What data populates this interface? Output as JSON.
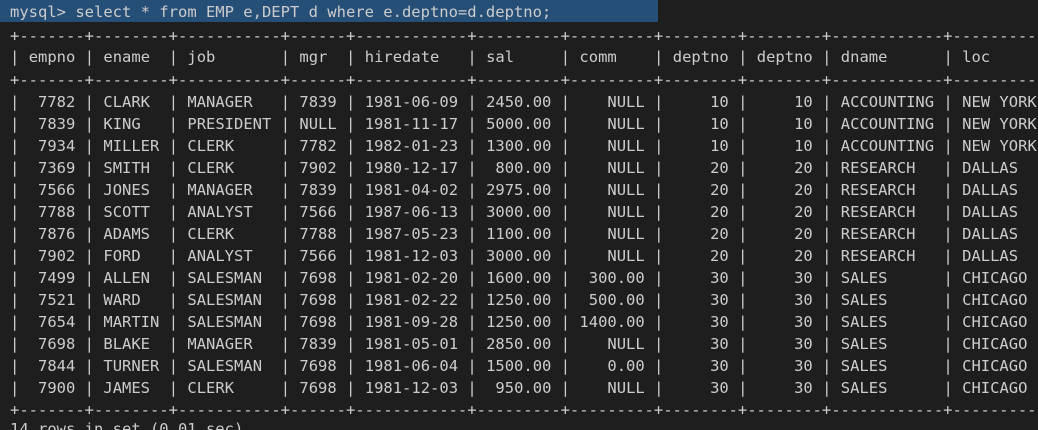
{
  "terminal": {
    "prompt": "mysql>",
    "command": " select * from EMP e,DEPT d where e.deptno=d.deptno;"
  },
  "table": {
    "border": "+-------+--------+-----------+------+------------+---------+---------+--------+--------+------------+----------+",
    "columns": [
      "empno",
      "ename",
      "job",
      "mgr",
      "hiredate",
      "sal",
      "comm",
      "deptno",
      "deptno",
      "dname",
      "loc"
    ],
    "rows": [
      [
        "7782",
        "CLARK",
        "MANAGER",
        "7839",
        "1981-06-09",
        "2450.00",
        "NULL",
        "10",
        "10",
        "ACCOUNTING",
        "NEW YORK"
      ],
      [
        "7839",
        "KING",
        "PRESIDENT",
        "NULL",
        "1981-11-17",
        "5000.00",
        "NULL",
        "10",
        "10",
        "ACCOUNTING",
        "NEW YORK"
      ],
      [
        "7934",
        "MILLER",
        "CLERK",
        "7782",
        "1982-01-23",
        "1300.00",
        "NULL",
        "10",
        "10",
        "ACCOUNTING",
        "NEW YORK"
      ],
      [
        "7369",
        "SMITH",
        "CLERK",
        "7902",
        "1980-12-17",
        "800.00",
        "NULL",
        "20",
        "20",
        "RESEARCH",
        "DALLAS"
      ],
      [
        "7566",
        "JONES",
        "MANAGER",
        "7839",
        "1981-04-02",
        "2975.00",
        "NULL",
        "20",
        "20",
        "RESEARCH",
        "DALLAS"
      ],
      [
        "7788",
        "SCOTT",
        "ANALYST",
        "7566",
        "1987-06-13",
        "3000.00",
        "NULL",
        "20",
        "20",
        "RESEARCH",
        "DALLAS"
      ],
      [
        "7876",
        "ADAMS",
        "CLERK",
        "7788",
        "1987-05-23",
        "1100.00",
        "NULL",
        "20",
        "20",
        "RESEARCH",
        "DALLAS"
      ],
      [
        "7902",
        "FORD",
        "ANALYST",
        "7566",
        "1981-12-03",
        "3000.00",
        "NULL",
        "20",
        "20",
        "RESEARCH",
        "DALLAS"
      ],
      [
        "7499",
        "ALLEN",
        "SALESMAN",
        "7698",
        "1981-02-20",
        "1600.00",
        "300.00",
        "30",
        "30",
        "SALES",
        "CHICAGO"
      ],
      [
        "7521",
        "WARD",
        "SALESMAN",
        "7698",
        "1981-02-22",
        "1250.00",
        "500.00",
        "30",
        "30",
        "SALES",
        "CHICAGO"
      ],
      [
        "7654",
        "MARTIN",
        "SALESMAN",
        "7698",
        "1981-09-28",
        "1250.00",
        "1400.00",
        "30",
        "30",
        "SALES",
        "CHICAGO"
      ],
      [
        "7698",
        "BLAKE",
        "MANAGER",
        "7839",
        "1981-05-01",
        "2850.00",
        "NULL",
        "30",
        "30",
        "SALES",
        "CHICAGO"
      ],
      [
        "7844",
        "TURNER",
        "SALESMAN",
        "7698",
        "1981-06-04",
        "1500.00",
        "0.00",
        "30",
        "30",
        "SALES",
        "CHICAGO"
      ],
      [
        "7900",
        "JAMES",
        "CLERK",
        "7698",
        "1981-12-03",
        "950.00",
        "NULL",
        "30",
        "30",
        "SALES",
        "CHICAGO"
      ]
    ]
  },
  "footer": "14 rows in set (0.01 sec)",
  "colors": {
    "background": "#1e1e1e",
    "text": "#cccccc",
    "selection": "#264f78"
  }
}
